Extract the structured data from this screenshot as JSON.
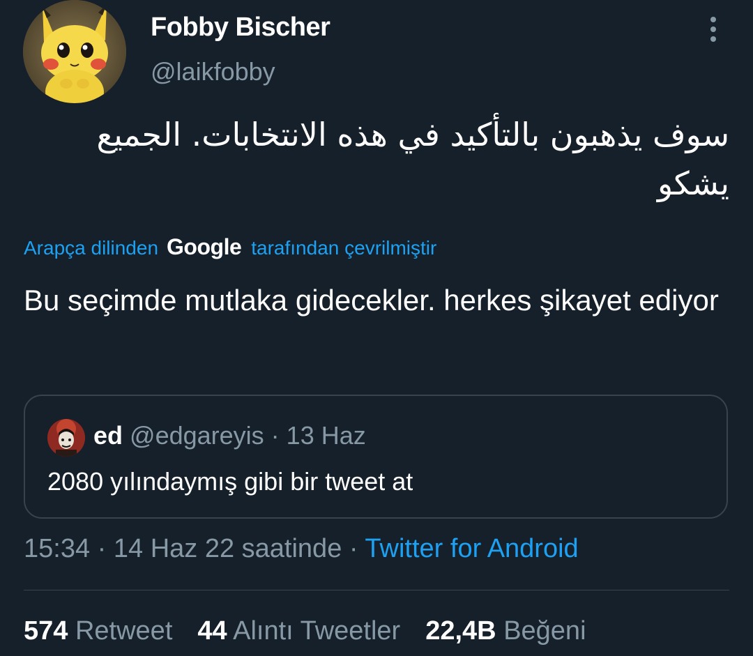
{
  "colors": {
    "background": "#15202b",
    "text_primary": "#ffffff",
    "text_secondary": "#8899a6",
    "accent": "#1da1f2",
    "border": "#38444d"
  },
  "tweet": {
    "author_name": "Fobby Bischer",
    "author_handle": "@laikfobby",
    "avatar_icon": "pikachu-avatar",
    "more_icon": "vertical-dots-icon",
    "original_text": "سوف يذهبون بالتأكيد في هذه الانتخابات. الجميع يشكو",
    "translation": {
      "prefix": "Arapça dilinden",
      "provider": "Google",
      "suffix": "tarafından çevrilmiştir"
    },
    "translated_text": "Bu seçimde mutlaka gidecekler. herkes şikayet ediyor"
  },
  "quote": {
    "author_name": "ed",
    "author_handle": "@edgareyis",
    "separator": " · ",
    "date": "13 Haz",
    "text": "2080 yılındaymış gibi bir tweet at"
  },
  "meta": {
    "time": "15:34",
    "sep1": " · ",
    "date": "14 Haz 22 saatinde",
    "sep2": " · ",
    "source": "Twitter for Android"
  },
  "stats": {
    "retweets": {
      "count": "574",
      "label": "Retweet"
    },
    "quotes": {
      "count": "44",
      "label": "Alıntı Tweetler"
    },
    "likes": {
      "count": "22,4B",
      "label": "Beğeni"
    }
  }
}
